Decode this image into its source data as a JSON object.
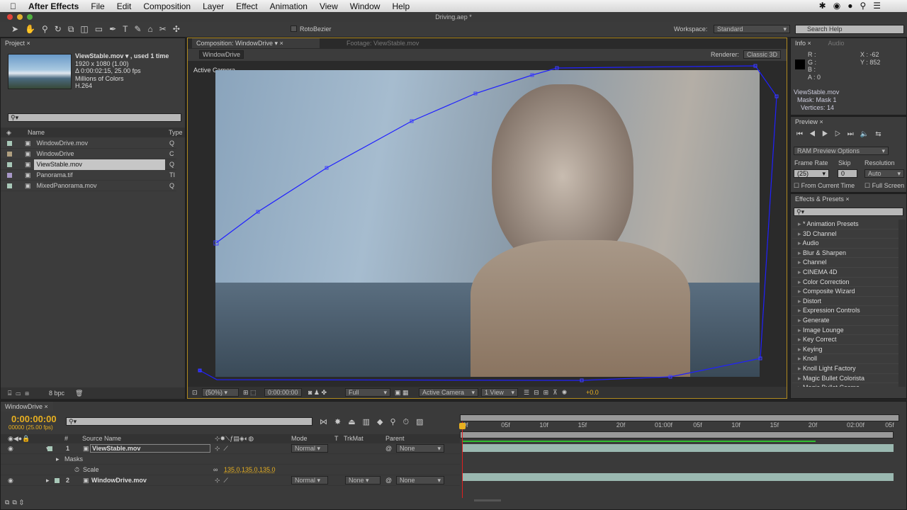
{
  "menubar": {
    "apple": "",
    "app": "After Effects",
    "items": [
      "File",
      "Edit",
      "Composition",
      "Layer",
      "Effect",
      "Animation",
      "View",
      "Window",
      "Help"
    ]
  },
  "window_title": "Driving.aep *",
  "toolbar": {
    "rotobezier": "RotoBezier",
    "workspace_label": "Workspace:",
    "workspace_value": "Standard",
    "search_help": "Search Help"
  },
  "project": {
    "tab": "Project",
    "info": {
      "name": "ViewStable.mov ▾ , used 1 time",
      "size": "1920 x 1080 (1.00)",
      "duration": "Δ 0:00:02:15, 25.00 fps",
      "colors": "Millions of Colors",
      "codec": "H.264"
    },
    "col_name": "Name",
    "col_type": "Type",
    "items": [
      {
        "name": "WindowDrive.mov",
        "type": "Q",
        "color": "#a8c8b8"
      },
      {
        "name": "WindowDrive",
        "type": "C",
        "color": "#b0a080"
      },
      {
        "name": "ViewStable.mov",
        "type": "Q",
        "color": "#a8c8b8",
        "selected": true
      },
      {
        "name": "Panorama.tif",
        "type": "TI",
        "color": "#a898c8"
      },
      {
        "name": "MixedPanorama.mov",
        "type": "Q",
        "color": "#a8c8b8"
      }
    ],
    "bpc": "8 bpc"
  },
  "comp": {
    "tab": "Composition: WindowDrive",
    "footage_tab": "Footage: ViewStable.mov",
    "subtab": "WindowDrive",
    "renderer_label": "Renderer:",
    "renderer": "Classic 3D",
    "camera_label": "Active Camera",
    "footer": {
      "zoom": "(50%)",
      "timecode": "0:00:00:00",
      "resolution": "Full",
      "view": "Active Camera",
      "views": "1 View",
      "exposure": "+0.0"
    }
  },
  "info": {
    "tab": "Info",
    "audio_tab": "Audio",
    "r": "R :",
    "g": "G :",
    "b": "B :",
    "a": "A : 0",
    "x": "X : -62",
    "y": "Y : 852",
    "layer": "ViewStable.mov",
    "mask": "Mask: Mask 1",
    "vertices": "Vertices: 14"
  },
  "preview": {
    "tab": "Preview",
    "ram_options": "RAM Preview Options",
    "frame_rate_label": "Frame Rate",
    "skip_label": "Skip",
    "resolution_label": "Resolution",
    "frame_rate": "(25)",
    "skip": "0",
    "resolution": "Auto",
    "from_current": "From Current Time",
    "full_screen": "Full Screen"
  },
  "effects": {
    "tab": "Effects & Presets",
    "items": [
      "* Animation Presets",
      "3D Channel",
      "Audio",
      "Blur & Sharpen",
      "Channel",
      "CINEMA 4D",
      "Color Correction",
      "Composite Wizard",
      "Distort",
      "Expression Controls",
      "Generate",
      "Image Lounge",
      "Key Correct",
      "Keying",
      "Knoll",
      "Knoll Light Factory",
      "Magic Bullet Colorista",
      "Magic Bullet Cosmo"
    ]
  },
  "timeline": {
    "tab": "WindowDrive",
    "timecode": "0:00:00:00",
    "frames": "00000 (25.00 fps)",
    "cols": {
      "num": "#",
      "source": "Source Name",
      "mode": "Mode",
      "t": "T",
      "trkmat": "TrkMat",
      "parent": "Parent"
    },
    "layers": [
      {
        "num": "1",
        "name": "ViewStable.mov",
        "mode": "Normal",
        "trkmat": "",
        "parent": "None"
      },
      {
        "num": "2",
        "name": "WindowDrive.mov",
        "mode": "Normal",
        "trkmat": "None",
        "parent": "None"
      }
    ],
    "masks": "Masks",
    "scale_label": "Scale",
    "scale_value": "135.0,135.0,135.0",
    "ruler": [
      "0f",
      "05f",
      "10f",
      "15f",
      "20f",
      "01:00f",
      "05f",
      "10f",
      "15f",
      "20f",
      "02:00f",
      "05f"
    ]
  },
  "colors": {
    "accent": "#e8b020",
    "mask": "#2020ff",
    "work_area": "#30c030"
  }
}
